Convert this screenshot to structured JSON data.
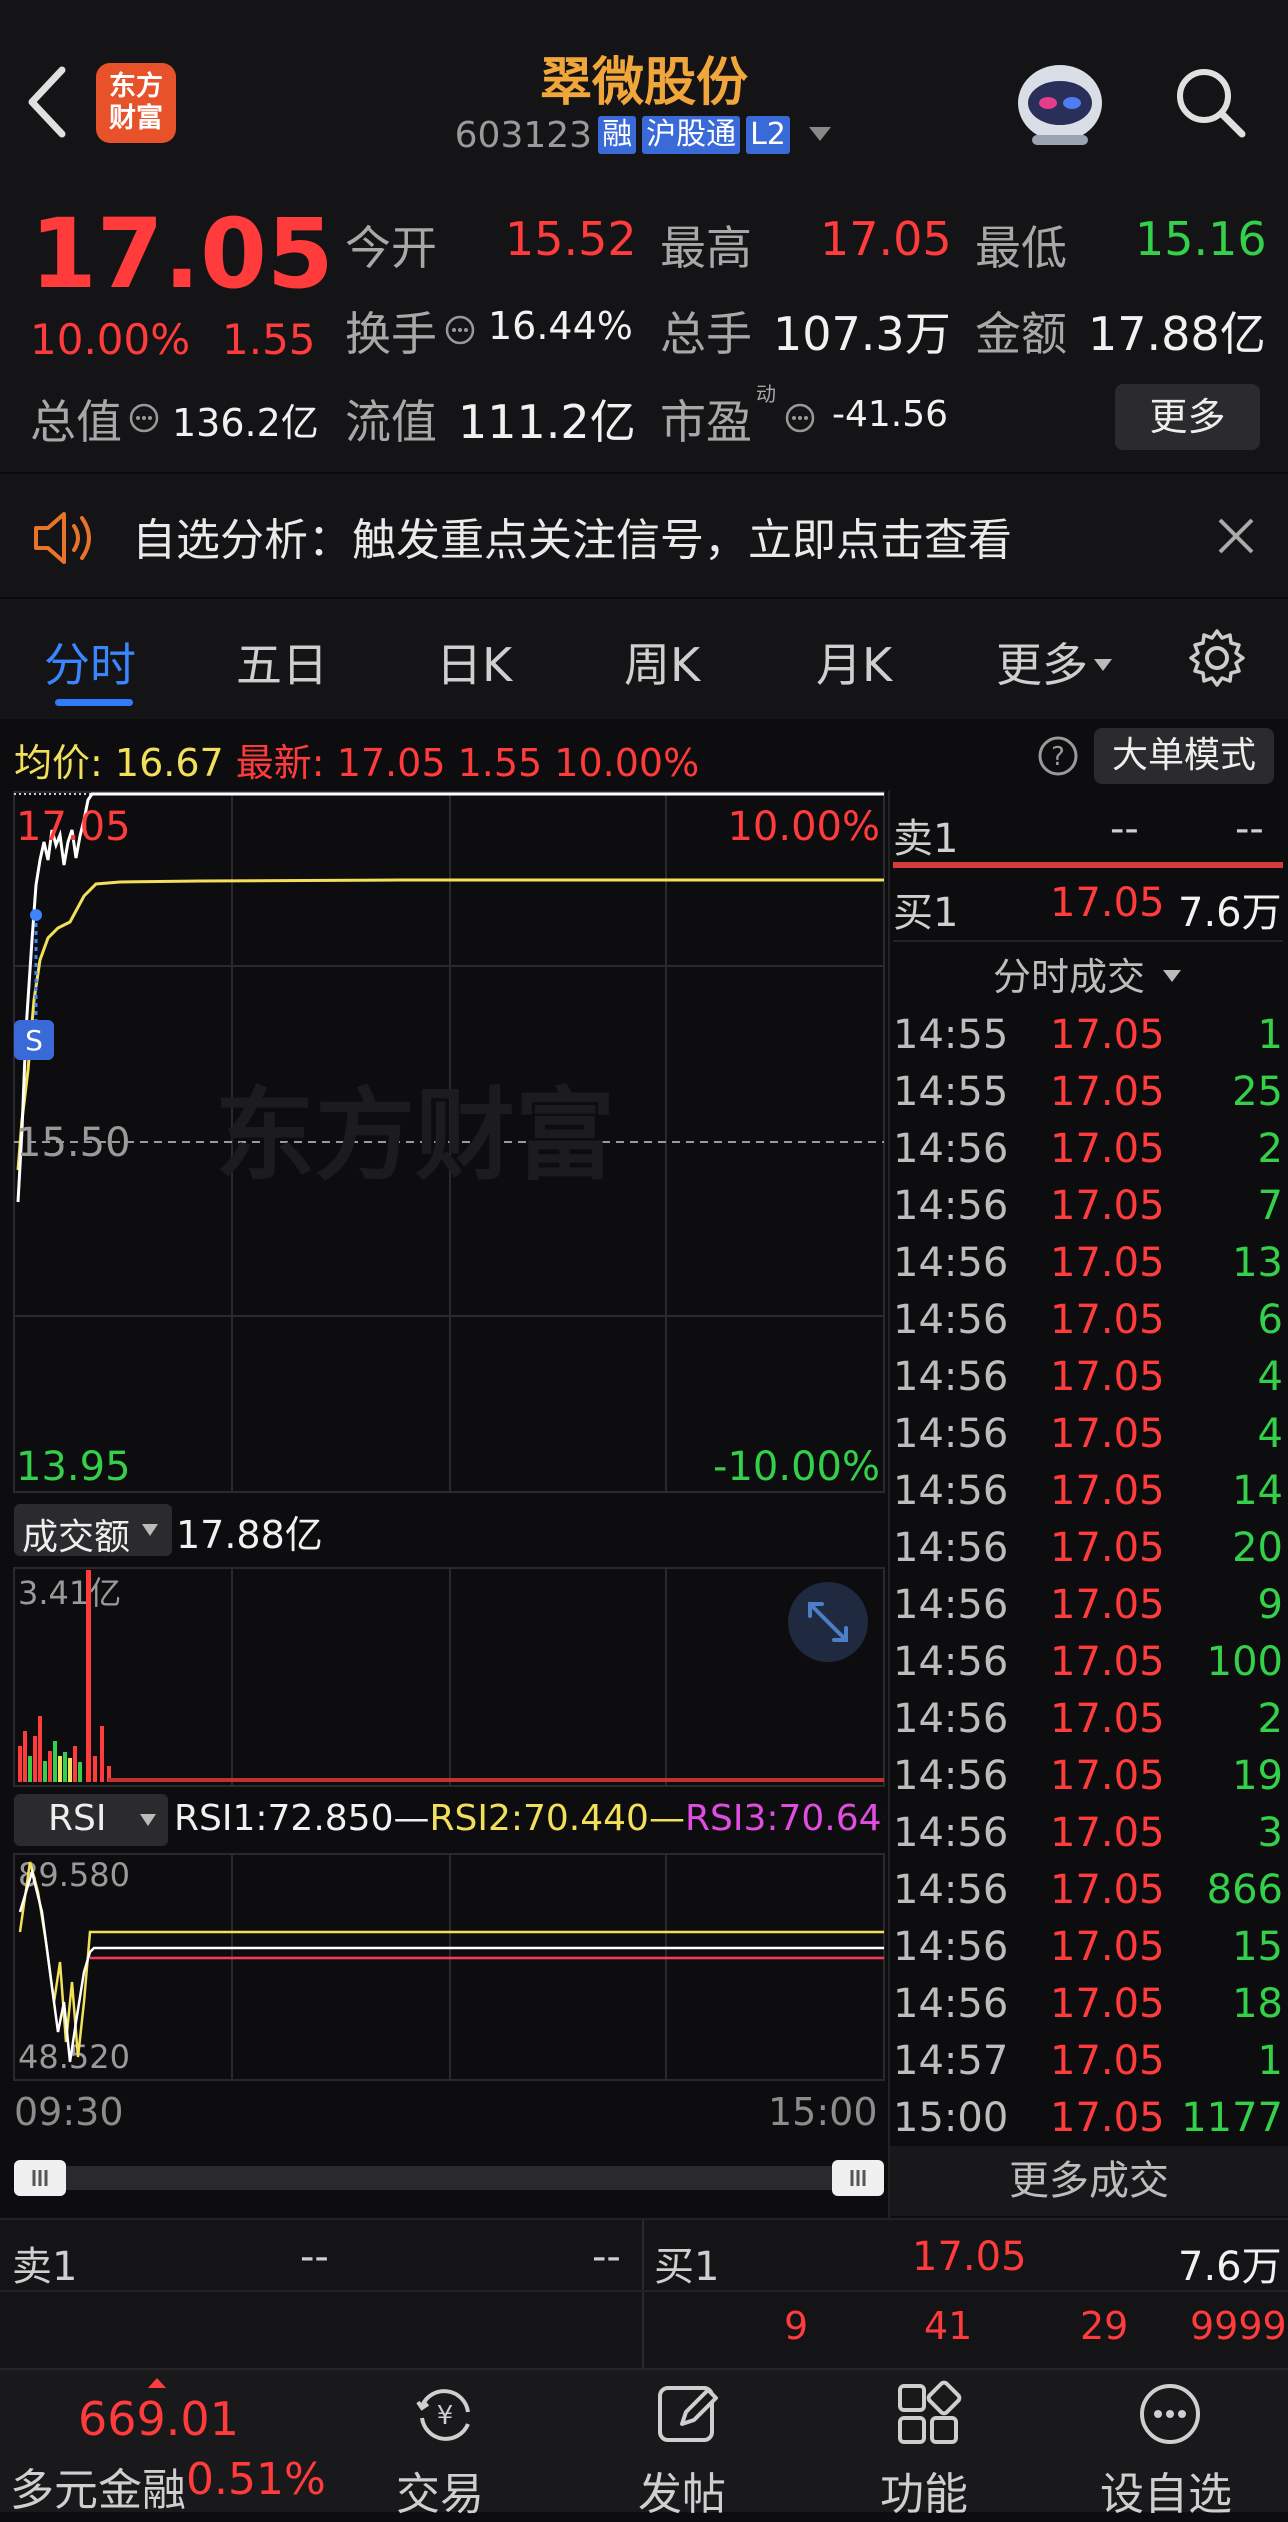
{
  "header": {
    "logo_line1": "东方",
    "logo_line2": "财富",
    "title": "翠微股份",
    "code": "603123",
    "tags": [
      "融",
      "沪股通",
      "L2"
    ]
  },
  "quote": {
    "price": "17.05",
    "change_pct": "10.00%",
    "change_abs": "1.55",
    "open_label": "今开",
    "open": "15.52",
    "high_label": "最高",
    "high": "17.05",
    "low_label": "最低",
    "low": "15.16",
    "turnover_label": "换手",
    "turnover": "16.44%",
    "volume_label": "总手",
    "volume": "107.3万",
    "amount_label": "金额",
    "amount": "17.88亿",
    "mktcap_label": "总值",
    "mktcap": "136.2亿",
    "float_label": "流值",
    "float": "111.2亿",
    "pe_label": "市盈",
    "pe_sup": "动",
    "pe": "-41.56",
    "more_label": "更多"
  },
  "banner": {
    "text": "自选分析：触发重点关注信号，立即点击查看"
  },
  "tabs": [
    "分时",
    "五日",
    "日K",
    "周K",
    "月K",
    "更多"
  ],
  "infobar": {
    "avg_label": "均价:",
    "avg": "16.67",
    "latest_label": "最新:",
    "latest": "17.05",
    "latest_chg": "1.55",
    "latest_pct": "10.00%",
    "bigorder_label": "大单模式"
  },
  "chart_main": {
    "y_top": "17.05",
    "y_mid": "15.50",
    "y_bottom": "13.95",
    "pct_top": "10.00%",
    "pct_bottom": "-10.00%",
    "marker": "S",
    "watermark": "东方财富"
  },
  "volume_panel": {
    "label": "成交额",
    "value": "17.88亿",
    "ymax": "3.41亿"
  },
  "rsi_panel": {
    "label": "RSI",
    "rsi1": "RSI1:72.850",
    "rsi2": "RSI2:70.440",
    "rsi3": "RSI3:70.640",
    "ytop": "89.580",
    "ybottom": "48.520"
  },
  "time_axis": {
    "start": "09:30",
    "end": "15:00"
  },
  "side_book": {
    "sell1_label": "卖1",
    "sell1_price": "--",
    "sell1_vol": "--",
    "buy1_label": "买1",
    "buy1_price": "17.05",
    "buy1_vol": "7.6万"
  },
  "trades_header": "分时成交",
  "trades": [
    {
      "time": "14:55",
      "price": "17.05",
      "vol": "1"
    },
    {
      "time": "14:55",
      "price": "17.05",
      "vol": "25"
    },
    {
      "time": "14:56",
      "price": "17.05",
      "vol": "2"
    },
    {
      "time": "14:56",
      "price": "17.05",
      "vol": "7"
    },
    {
      "time": "14:56",
      "price": "17.05",
      "vol": "13"
    },
    {
      "time": "14:56",
      "price": "17.05",
      "vol": "6"
    },
    {
      "time": "14:56",
      "price": "17.05",
      "vol": "4"
    },
    {
      "time": "14:56",
      "price": "17.05",
      "vol": "4"
    },
    {
      "time": "14:56",
      "price": "17.05",
      "vol": "14"
    },
    {
      "time": "14:56",
      "price": "17.05",
      "vol": "20"
    },
    {
      "time": "14:56",
      "price": "17.05",
      "vol": "9"
    },
    {
      "time": "14:56",
      "price": "17.05",
      "vol": "100"
    },
    {
      "time": "14:56",
      "price": "17.05",
      "vol": "2"
    },
    {
      "time": "14:56",
      "price": "17.05",
      "vol": "19"
    },
    {
      "time": "14:56",
      "price": "17.05",
      "vol": "3"
    },
    {
      "time": "14:56",
      "price": "17.05",
      "vol": "866"
    },
    {
      "time": "14:56",
      "price": "17.05",
      "vol": "15"
    },
    {
      "time": "14:56",
      "price": "17.05",
      "vol": "18"
    },
    {
      "time": "14:57",
      "price": "17.05",
      "vol": "1"
    },
    {
      "time": "15:00",
      "price": "17.05",
      "vol": "1177"
    }
  ],
  "more_trades_label": "更多成交",
  "bottom_book": {
    "sell1_label": "卖1",
    "sell1_price": "--",
    "sell1_vol": "--",
    "buy1_label": "买1",
    "buy1_price": "17.05",
    "buy1_vol": "7.6万",
    "queue": [
      "9",
      "41",
      "29",
      "9999"
    ]
  },
  "nav": {
    "index_value": "669.01",
    "index_name": "多元金融",
    "index_pct": "0.51%",
    "items": [
      "交易",
      "发帖",
      "功能",
      "设自选"
    ]
  }
}
